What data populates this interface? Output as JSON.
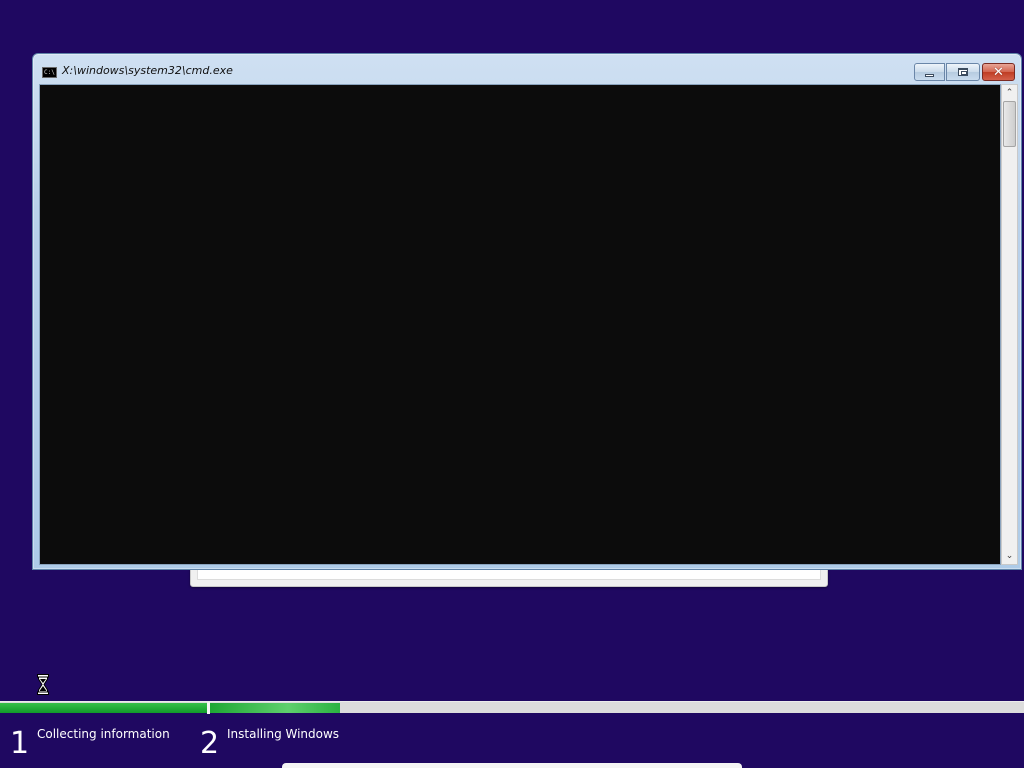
{
  "console": {
    "title": "X:\\windows\\system32\\cmd.exe",
    "icon": "cmd-icon",
    "icon_text": "C:\\",
    "buttons": {
      "minimize_icon": "minimize-icon",
      "maximize_icon": "maximize-icon",
      "close_icon": "close-icon",
      "close_glyph": "✕"
    },
    "scroll_up_glyph": "⌃",
    "scroll_down_glyph": "⌄",
    "output_text": ""
  },
  "progress": {
    "step1_fraction": 1.0,
    "step2_fraction": 0.16
  },
  "steps": [
    {
      "number": "1",
      "label": "Collecting information"
    },
    {
      "number": "2",
      "label": "Installing Windows"
    }
  ],
  "cursor": {
    "icon": "hourglass-icon"
  },
  "colors": {
    "desktop_background": "#1f0861",
    "console_background": "#0c0c0c",
    "progress_green": "#1ea734",
    "close_red": "#c9442c"
  }
}
